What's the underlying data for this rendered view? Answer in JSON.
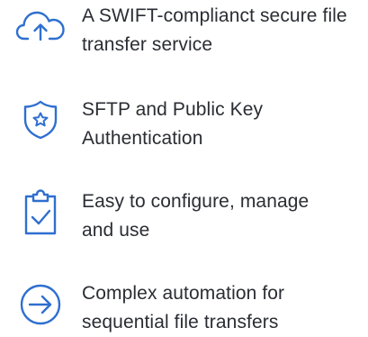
{
  "accent_color": "#2f6fd0",
  "text_color": "#2a2d33",
  "features": [
    {
      "icon": "cloud-upload-icon",
      "line1": "A SWIFT-complianct secure file",
      "line2": "transfer service"
    },
    {
      "icon": "shield-star-icon",
      "line1": "SFTP  and Public Key",
      "line2": "Authentication"
    },
    {
      "icon": "clipboard-check-icon",
      "line1": "Easy to configure, manage",
      "line2": "and use"
    },
    {
      "icon": "arrow-circle-right-icon",
      "line1": "Complex automation for",
      "line2": "sequential file transfers"
    }
  ]
}
